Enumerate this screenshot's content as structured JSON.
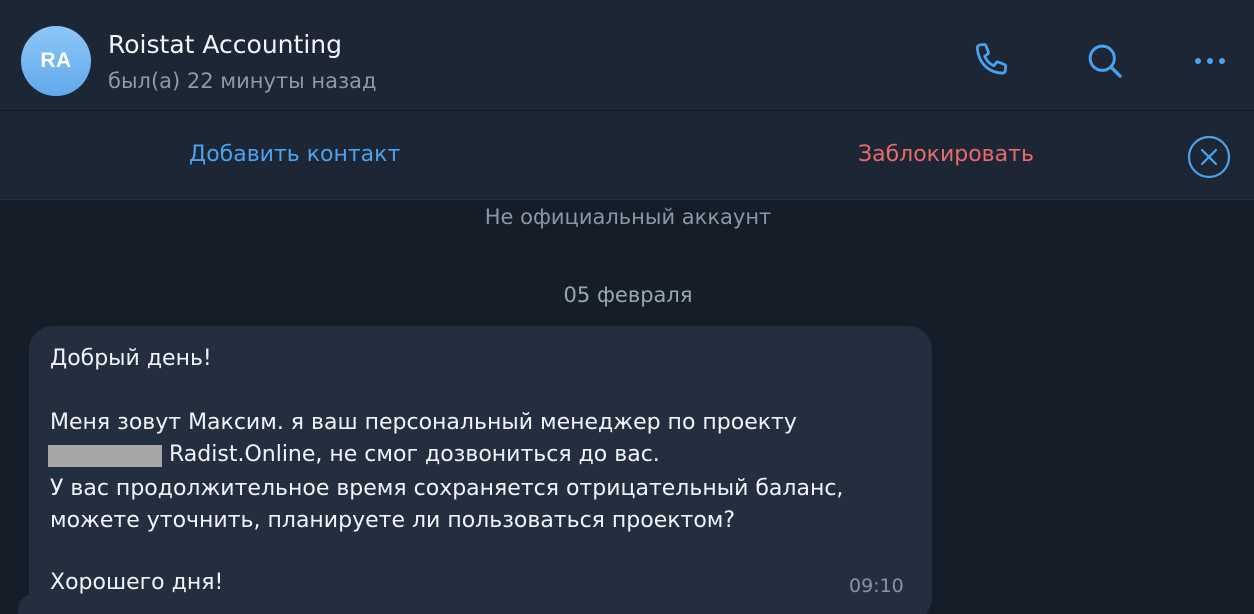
{
  "header": {
    "avatar_initials": "RA",
    "title": "Roistat Accounting",
    "status": "был(а) 22 минуты назад"
  },
  "actions": {
    "add_contact": "Добавить контакт",
    "block": "Заблокировать"
  },
  "chat": {
    "notice": "Не официальный аккаунт",
    "date": "05 февраля",
    "message": {
      "line1": "Добрый день!",
      "line2": "Меня зовут Максим. я ваш персональный менеджер по проекту",
      "line3": "Radist.Online, не смог дозвониться до вас.",
      "line4": "У вас продолжительное время сохраняется отрицательный баланс,",
      "line5": "можете уточнить, планируете ли пользоваться проектом?",
      "line6": "Хорошего дня!",
      "time": "09:10"
    }
  },
  "colors": {
    "accent": "#4aa3ef",
    "danger": "#e86a6a",
    "background": "#151d28",
    "bubble": "#232f3f"
  },
  "icons": [
    "phone-icon",
    "search-icon",
    "more-icon",
    "close-circle-icon"
  ]
}
